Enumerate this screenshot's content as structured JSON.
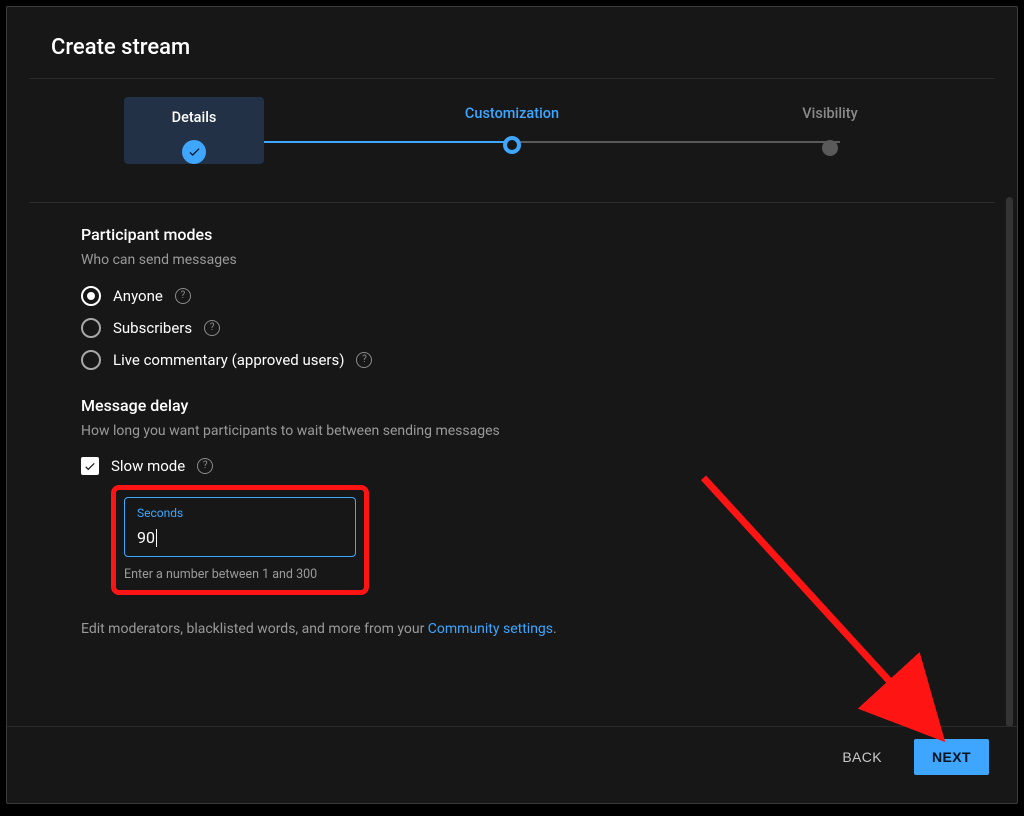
{
  "header": {
    "title": "Create stream"
  },
  "stepper": {
    "steps": [
      {
        "label": "Details",
        "state": "done"
      },
      {
        "label": "Customization",
        "state": "current"
      },
      {
        "label": "Visibility",
        "state": "upcoming"
      }
    ]
  },
  "participant_modes": {
    "heading": "Participant modes",
    "subhead": "Who can send messages",
    "options": [
      {
        "label": "Anyone",
        "selected": true
      },
      {
        "label": "Subscribers",
        "selected": false
      },
      {
        "label": "Live commentary (approved users)",
        "selected": false
      }
    ]
  },
  "message_delay": {
    "heading": "Message delay",
    "subhead": "How long you want participants to wait between sending messages",
    "slow_mode": {
      "label": "Slow mode",
      "checked": true
    },
    "seconds_field": {
      "label": "Seconds",
      "value": "90",
      "hint": "Enter a number between 1 and 300"
    }
  },
  "footnote": {
    "prefix": "Edit moderators, blacklisted words, and more from your ",
    "link_text": "Community settings",
    "suffix": "."
  },
  "footer": {
    "back": "BACK",
    "next": "NEXT"
  },
  "colors": {
    "accent": "#3ea6ff",
    "highlight": "#ff1414"
  }
}
